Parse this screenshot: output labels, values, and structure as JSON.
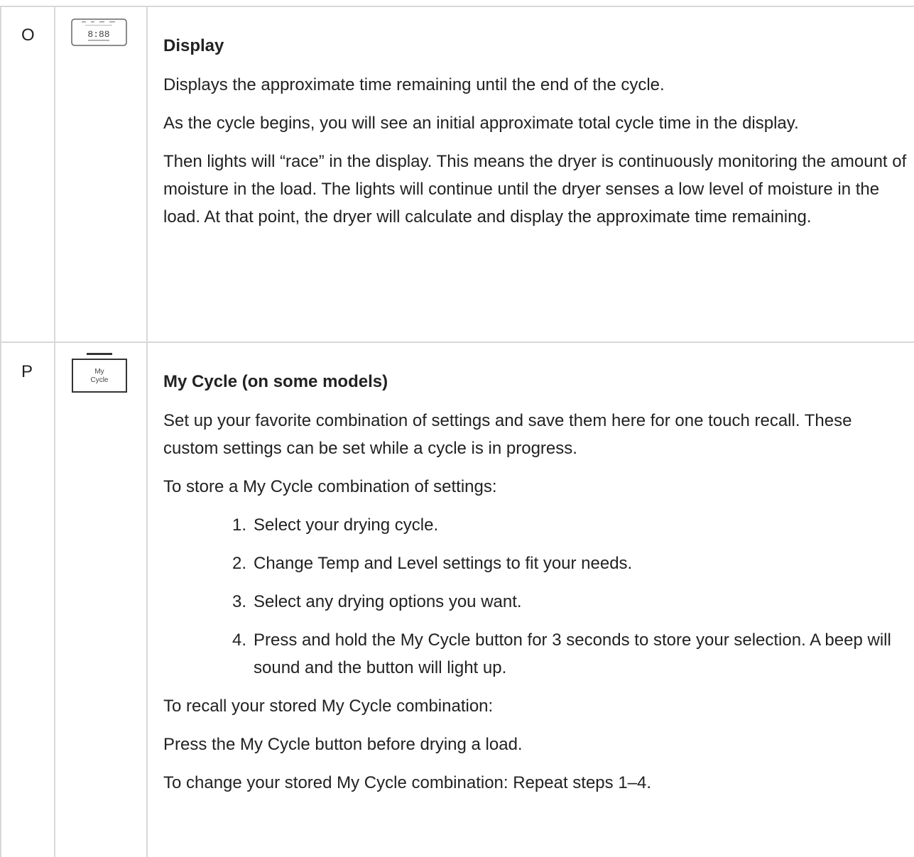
{
  "rows": [
    {
      "letter": "O",
      "icon": "display-panel-icon",
      "icon_digits": "8:88",
      "title": "Display",
      "paragraphs": [
        "Displays the approximate time remaining until the end of the cycle.",
        "As the cycle begins, you will see an initial approximate total cycle time in the display.",
        "Then lights will “race” in the display. This means the dryer is continuously monitoring the amount of moisture in the load. The lights will continue until the dryer senses a low level of moisture in the load. At that point, the dryer will calculate and display the approximate time remaining."
      ]
    },
    {
      "letter": "P",
      "icon": "my-cycle-button-icon",
      "icon_label_1": "My",
      "icon_label_2": "Cycle",
      "title": "My Cycle (on some models)",
      "intro": "Set up your favorite combination of settings and save them here for one touch recall. These custom settings can be set while a cycle is in progress.",
      "store_heading": "To store a My Cycle combination of settings:",
      "steps": [
        {
          "num": "1.",
          "text": "Select your drying cycle."
        },
        {
          "num": "2.",
          "text": "Change Temp and Level settings to fit your needs."
        },
        {
          "num": "3.",
          "text": "Select any drying options you want."
        },
        {
          "num": "4.",
          "text": "Press and hold the My Cycle button for 3 seconds to store your selection. A beep will sound and the button will light up."
        }
      ],
      "recall_heading": "To recall your stored My Cycle combination:",
      "recall_text": "Press the My Cycle button before drying a load.",
      "change_text": "To change your stored My Cycle combination: Repeat steps 1–4."
    }
  ]
}
